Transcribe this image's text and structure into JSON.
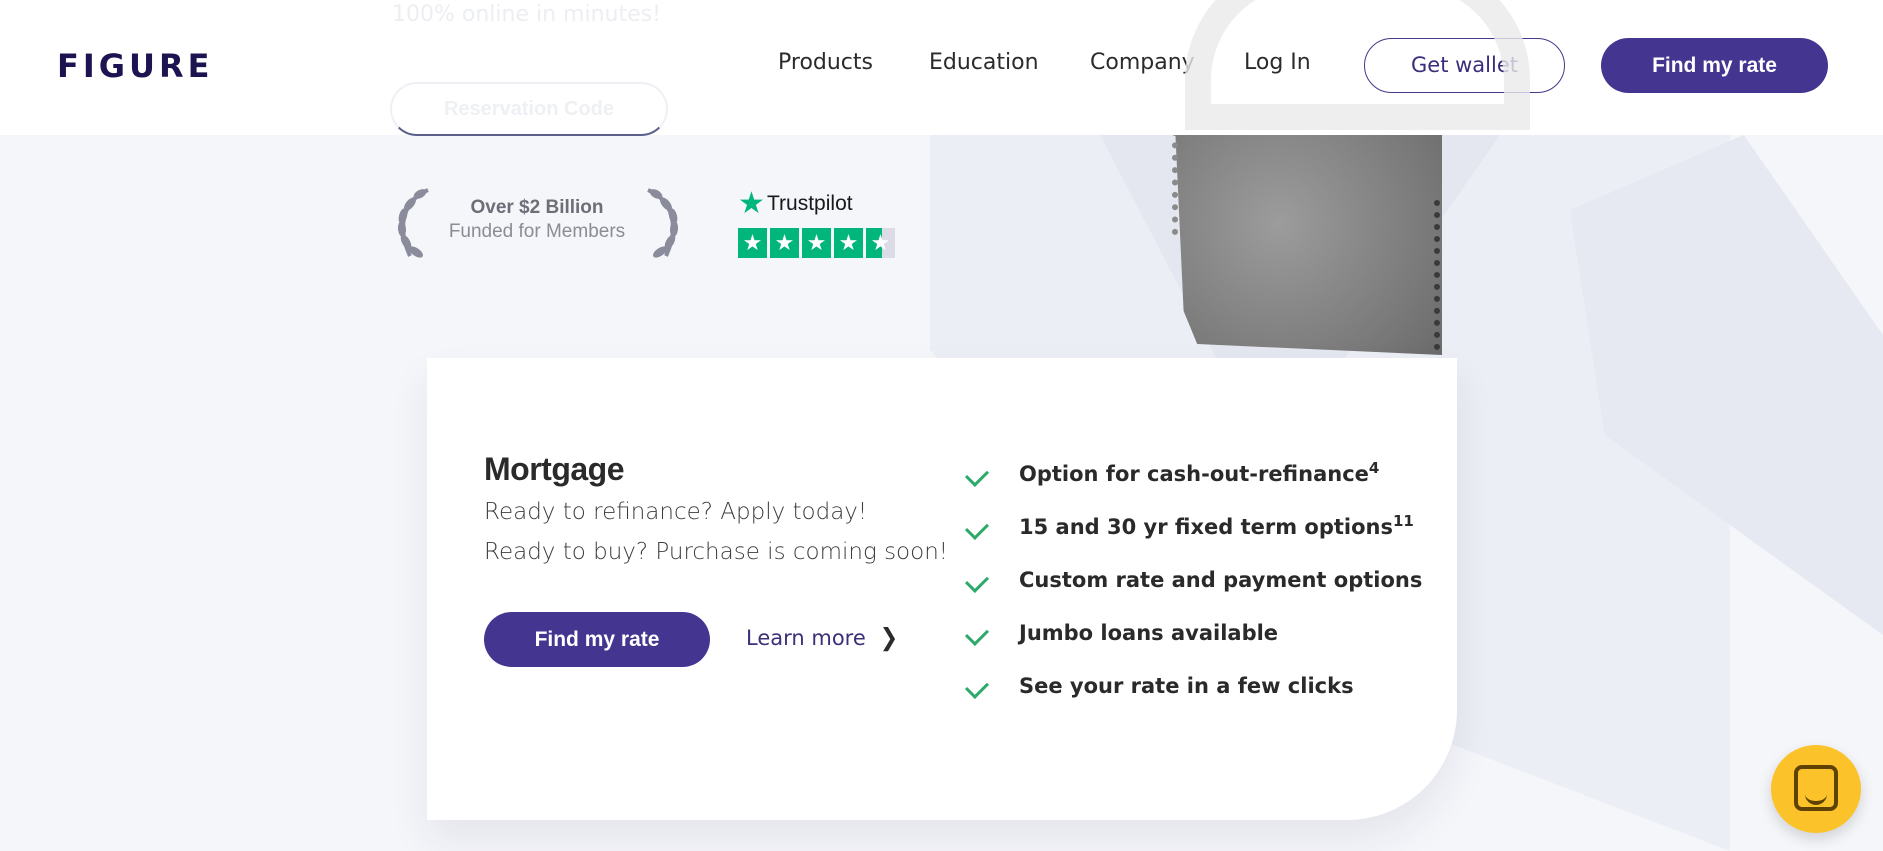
{
  "header": {
    "logo": "FIGURE",
    "nav": [
      "Products",
      "Education",
      "Company",
      "Log In"
    ],
    "get_wallet": "Get wallet",
    "find_rate": "Find my rate"
  },
  "hero_faded": {
    "text": "100% online in minutes!",
    "reservation_code": "Reservation Code"
  },
  "award": {
    "line1": "Over $2 Billion",
    "line2": "Funded for Members"
  },
  "trustpilot": {
    "name": "Trustpilot",
    "rating_stars": 4.5
  },
  "card": {
    "title": "Mortgage",
    "line1": "Ready to refinance? Apply today!",
    "line2": "Ready to buy? Purchase is coming soon!",
    "cta": "Find my rate",
    "learn_more": "Learn more",
    "features": [
      {
        "text": "Option for cash-out-refinance",
        "sup": "4"
      },
      {
        "text": "15 and 30 yr fixed term options",
        "sup": "11"
      },
      {
        "text": "Custom rate and payment options",
        "sup": ""
      },
      {
        "text": "Jumbo loans available",
        "sup": ""
      },
      {
        "text": "See your rate in a few clicks",
        "sup": ""
      }
    ]
  },
  "colors": {
    "brand": "#443690",
    "check": "#2daa6a",
    "trustpilot": "#00b67a",
    "chat": "#fbc22a"
  },
  "icons": [
    "laurel-left-icon",
    "laurel-right-icon",
    "trustpilot-star-icon",
    "check-icon",
    "chevron-right-icon",
    "chat-icon"
  ]
}
